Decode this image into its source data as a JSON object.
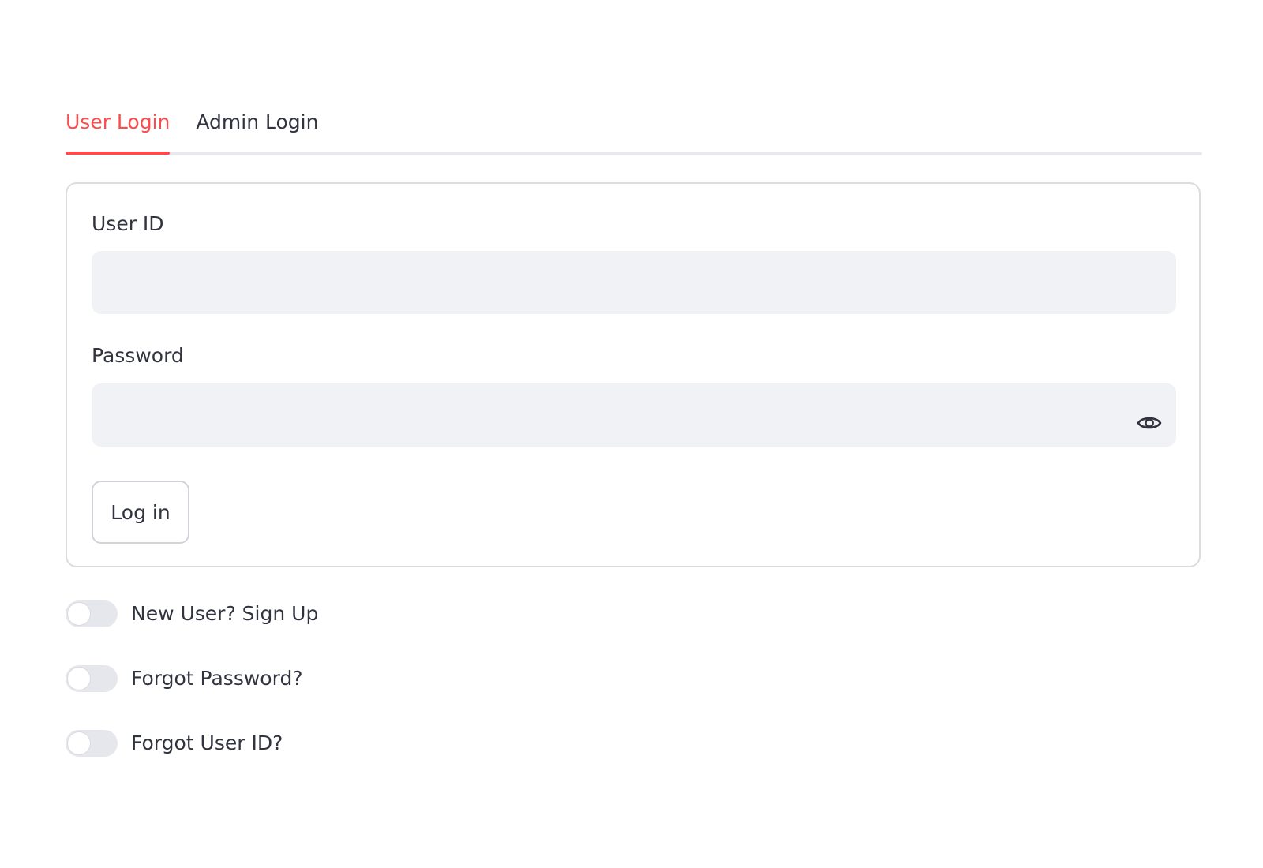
{
  "tabs": [
    {
      "label": "User Login",
      "active": true
    },
    {
      "label": "Admin Login",
      "active": false
    }
  ],
  "form": {
    "user_id": {
      "label": "User ID",
      "value": "",
      "placeholder": ""
    },
    "password": {
      "label": "Password",
      "value": "",
      "placeholder": ""
    },
    "login_button": "Log in"
  },
  "toggles": [
    {
      "label": "New User? Sign Up",
      "on": false
    },
    {
      "label": "Forgot Password?",
      "on": false
    },
    {
      "label": "Forgot User ID?",
      "on": false
    }
  ],
  "icons": {
    "password_visibility": "eye-icon"
  },
  "colors": {
    "accent": "#ff4b4b",
    "input_bg": "#f0f2f6",
    "text": "#31333f"
  }
}
